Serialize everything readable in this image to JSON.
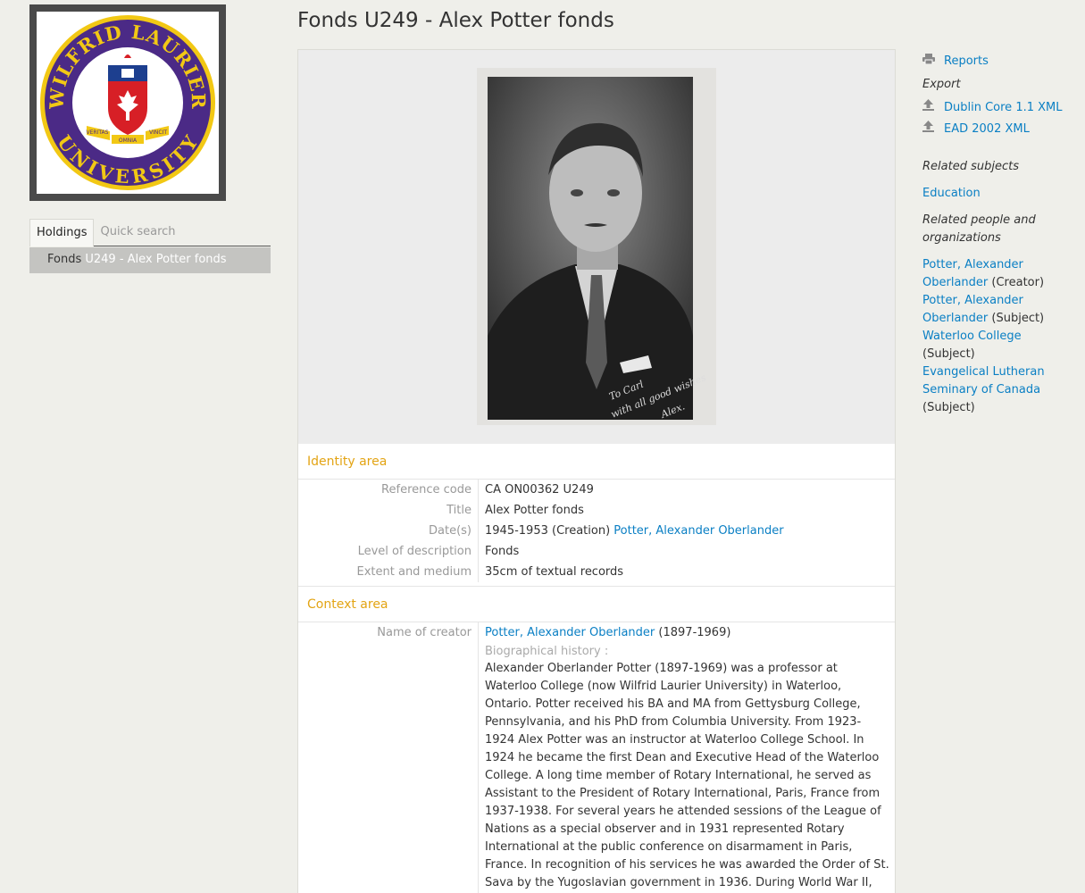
{
  "logo": {
    "text_top": "WILFRID LAURIER",
    "text_bottom": "UNIVERSITY",
    "motto": [
      "VERITAS",
      "OMNIA",
      "VINCIT"
    ]
  },
  "left": {
    "tabs": [
      {
        "label": "Holdings",
        "active": true
      },
      {
        "label": "Quick search",
        "active": false
      }
    ],
    "holdings_item": {
      "level": "Fonds",
      "title": "U249 - Alex Potter fonds"
    }
  },
  "page_title": "Fonds U249 - Alex Potter fonds",
  "photo": {
    "inscription": [
      "To Carl",
      "with all good wishes",
      "Alex."
    ]
  },
  "identity": {
    "heading": "Identity area",
    "reference_code": {
      "label": "Reference code",
      "value": "CA ON00362 U249"
    },
    "title": {
      "label": "Title",
      "value": "Alex Potter fonds"
    },
    "dates": {
      "label": "Date(s)",
      "value": "1945-1953 (Creation)",
      "link": "Potter, Alexander Oberlander"
    },
    "level": {
      "label": "Level of description",
      "value": "Fonds"
    },
    "extent": {
      "label": "Extent and medium",
      "value": "35cm of textual records"
    }
  },
  "context": {
    "heading": "Context area",
    "creator": {
      "label": "Name of creator",
      "link": "Potter, Alexander Oberlander",
      "dates": "(1897-1969)"
    },
    "bio_label": "Biographical history :",
    "bio_text": "Alexander Oberlander Potter (1897-1969) was a professor at Waterloo College (now Wilfrid Laurier University) in Waterloo, Ontario. Potter received his BA and MA from Gettysburg College, Pennsylvania, and his PhD from Columbia University. From 1923-1924 Alex Potter was an instructor at Waterloo College School. In 1924 he became the first Dean and Executive Head of the Waterloo College. A long time member of Rotary International, he served as Assistant to the President of Rotary International, Paris, France from 1937-1938. For several years he attended sessions of the League of Nations as a special observer and in 1931 represented Rotary International at the public conference on disarmament in Paris, France. In recognition of his services he was awarded the Order of St. Sava by the Yugoslavian government in 1936. During World War II, Potter worked for the Department of National War Services. After the war he returned to Waterloo College as a"
  },
  "sidebar": {
    "reports": "Reports",
    "export_heading": "Export",
    "dublin_core": "Dublin Core 1.1 XML",
    "ead": "EAD 2002 XML",
    "related_subjects_heading": "Related subjects",
    "subjects": [
      "Education"
    ],
    "related_people_heading": "Related people and organizations",
    "people": [
      {
        "name": "Potter, Alexander Oberlander",
        "role": "(Creator)"
      },
      {
        "name": "Potter, Alexander Oberlander",
        "role": "(Subject)"
      },
      {
        "name": "Waterloo College",
        "role": "(Subject)"
      },
      {
        "name": "Evangelical Lutheran Seminary of Canada",
        "role": "(Subject)"
      }
    ]
  }
}
